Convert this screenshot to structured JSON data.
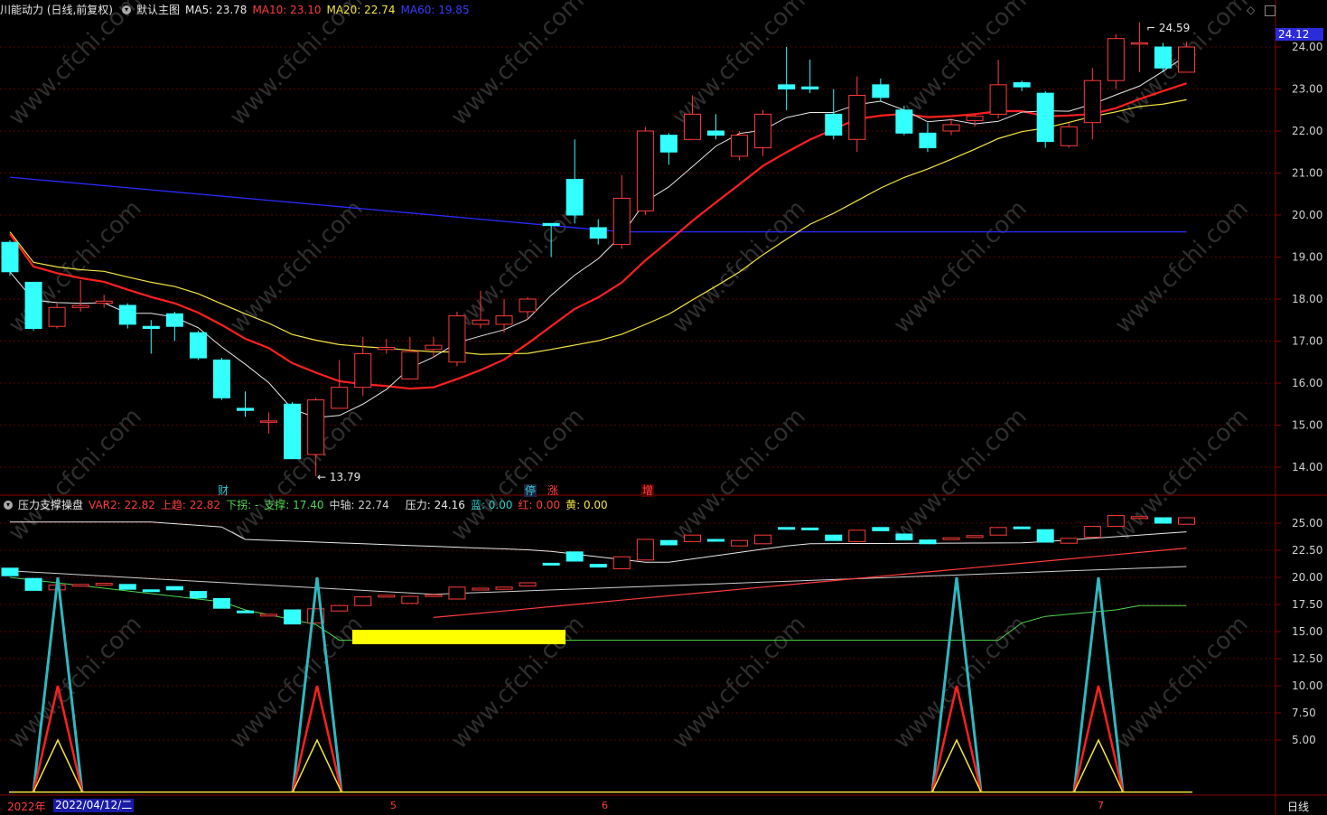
{
  "main": {
    "stock": "川能动力 (日线,前复权)",
    "template": "默认主图",
    "ma": [
      {
        "label": "MA5: 23.78",
        "color": "#e8e8e8"
      },
      {
        "label": "MA10: 23.10",
        "color": "#ff3b3b"
      },
      {
        "label": "MA20: 22.74",
        "color": "#f5e642"
      },
      {
        "label": "MA60: 19.85",
        "color": "#3a3aff"
      }
    ],
    "price_ticks": [
      "24.00",
      "23.00",
      "22.00",
      "21.00",
      "20.00",
      "19.00",
      "18.00",
      "17.00",
      "16.00",
      "15.00",
      "14.00"
    ],
    "last_price": "24.12",
    "high_label": "24.59",
    "low_label": "13.79",
    "markers": [
      {
        "text": "财",
        "bg": "transparent",
        "color": "#3cc"
      },
      {
        "text": "停",
        "bg": "#226",
        "color": "#3cc"
      },
      {
        "text": "涨",
        "bg": "transparent",
        "color": "#f44"
      },
      {
        "text": "增",
        "bg": "#600",
        "color": "#f44"
      }
    ]
  },
  "sub": {
    "indicator": "压力支撑操盘",
    "values": [
      {
        "label": "VAR2: 22.82",
        "color": "#ff3b3b"
      },
      {
        "label": "上趋: 22.82",
        "color": "#ff3b3b"
      },
      {
        "label": "下拐: -",
        "color": "#4cd84c"
      },
      {
        "label": "支撑: 17.40",
        "color": "#4cd84c"
      },
      {
        "label": "中轴: 22.74",
        "color": "#cfcfcf"
      },
      {
        "label": "压力: 24.16",
        "color": "#e8e8e8"
      },
      {
        "label": "蓝: 0.00",
        "color": "#33cccc"
      },
      {
        "label": "红: 0.00",
        "color": "#ff3b3b"
      },
      {
        "label": "黄: 0.00",
        "color": "#f5e642"
      }
    ],
    "ticks": [
      "25.00",
      "22.50",
      "20.00",
      "17.50",
      "15.00",
      "12.50",
      "10.00",
      "7.50",
      "5.00"
    ]
  },
  "timeline": {
    "year": "2022年",
    "cursor_date": "2022/04/12/二",
    "months": [
      "5",
      "6",
      "7"
    ],
    "period": "日线"
  },
  "watermark": "www.cfchi.com",
  "chart_data": {
    "type": "candlestick",
    "candles": [
      [
        19.35,
        18.65,
        18.55,
        19.4
      ],
      [
        18.4,
        17.3,
        17.25,
        18.4
      ],
      [
        17.35,
        17.8,
        17.3,
        17.9
      ],
      [
        17.8,
        17.85,
        17.7,
        18.45
      ],
      [
        17.9,
        17.95,
        17.8,
        18.1
      ],
      [
        17.85,
        17.4,
        17.3,
        17.9
      ],
      [
        17.35,
        17.3,
        16.7,
        17.5
      ],
      [
        17.65,
        17.35,
        17.0,
        17.7
      ],
      [
        17.2,
        16.6,
        16.55,
        17.25
      ],
      [
        16.55,
        15.65,
        15.6,
        16.6
      ],
      [
        15.4,
        15.35,
        15.2,
        15.8
      ],
      [
        15.1,
        15.1,
        14.8,
        15.3
      ],
      [
        15.5,
        14.2,
        14.2,
        15.55
      ],
      [
        14.3,
        15.6,
        13.79,
        15.65
      ],
      [
        15.4,
        15.9,
        15.4,
        16.55
      ],
      [
        15.9,
        16.7,
        15.7,
        17.1
      ],
      [
        16.8,
        16.85,
        16.7,
        17.05
      ],
      [
        16.1,
        16.75,
        16.1,
        17.1
      ],
      [
        16.8,
        16.9,
        16.6,
        17.1
      ],
      [
        16.5,
        17.6,
        16.4,
        17.7
      ],
      [
        17.4,
        17.5,
        17.3,
        18.2
      ],
      [
        17.4,
        17.6,
        17.2,
        18.0
      ],
      [
        17.7,
        18.0,
        17.5,
        18.05
      ],
      [
        19.8,
        19.75,
        19.0,
        19.8
      ],
      [
        20.85,
        20.0,
        19.8,
        21.8
      ],
      [
        19.7,
        19.45,
        19.3,
        19.9
      ],
      [
        19.3,
        20.4,
        19.2,
        20.95
      ],
      [
        20.1,
        22.0,
        20.0,
        22.1
      ],
      [
        21.9,
        21.5,
        21.2,
        21.95
      ],
      [
        21.8,
        22.4,
        21.8,
        22.85
      ],
      [
        22.0,
        21.9,
        21.8,
        22.4
      ],
      [
        21.4,
        21.9,
        21.3,
        22.0
      ],
      [
        21.6,
        22.4,
        21.4,
        22.5
      ],
      [
        23.1,
        23.0,
        22.5,
        24.0
      ],
      [
        23.05,
        23.0,
        22.9,
        23.7
      ],
      [
        22.4,
        21.9,
        21.8,
        23.0
      ],
      [
        21.8,
        22.85,
        21.5,
        23.3
      ],
      [
        23.1,
        22.8,
        22.7,
        23.25
      ],
      [
        22.5,
        21.95,
        21.9,
        22.6
      ],
      [
        21.95,
        21.6,
        21.5,
        22.2
      ],
      [
        22.0,
        22.15,
        21.9,
        22.3
      ],
      [
        22.25,
        22.35,
        22.1,
        22.4
      ],
      [
        22.4,
        23.1,
        22.3,
        23.7
      ],
      [
        23.15,
        23.05,
        22.95,
        23.2
      ],
      [
        22.9,
        21.75,
        21.6,
        22.95
      ],
      [
        21.65,
        22.1,
        21.6,
        22.2
      ],
      [
        22.2,
        23.2,
        21.8,
        23.5
      ],
      [
        23.2,
        24.2,
        23.0,
        24.3
      ],
      [
        24.1,
        24.1,
        23.4,
        24.59
      ],
      [
        24.0,
        23.5,
        23.4,
        24.1
      ],
      [
        23.4,
        24.0,
        23.4,
        24.12
      ]
    ]
  }
}
